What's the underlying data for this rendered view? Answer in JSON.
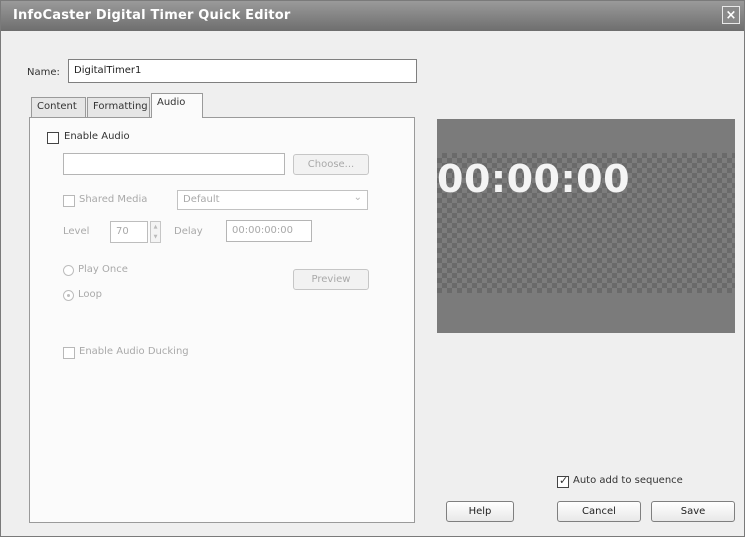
{
  "window": {
    "title": "InfoCaster Digital Timer Quick Editor",
    "close_glyph": "×"
  },
  "name_field": {
    "label": "Name:",
    "value": "DigitalTimer1"
  },
  "tabs": [
    {
      "label": "Content"
    },
    {
      "label": "Formatting"
    },
    {
      "label": "Audio"
    }
  ],
  "audio": {
    "enable_audio_label": "Enable Audio",
    "enable_audio_checked": false,
    "file_path": "",
    "choose_label": "Choose...",
    "shared_media_label": "Shared Media",
    "shared_media_checked": false,
    "shared_media_select": "Default",
    "level_label": "Level",
    "level_value": "70",
    "delay_label": "Delay",
    "delay_value": "00:00:00:00",
    "play_once_label": "Play Once",
    "loop_label": "Loop",
    "loop_selected": true,
    "preview_label": "Preview",
    "audio_ducking_label": "Enable Audio Ducking",
    "audio_ducking_checked": false
  },
  "preview": {
    "timer_text": "00:00:00"
  },
  "footer": {
    "auto_add_label": "Auto add to sequence",
    "auto_add_checked": true,
    "help_label": "Help",
    "cancel_label": "Cancel",
    "save_label": "Save"
  },
  "icons": {
    "spinner_up": "▲",
    "spinner_down": "▼",
    "dropdown": "⌄"
  },
  "colors": {
    "titlebar": "#7e7e7e",
    "window_bg": "#efefef",
    "preview_bg": "#7b7b7b",
    "timer_text": "#f4f4f4"
  }
}
